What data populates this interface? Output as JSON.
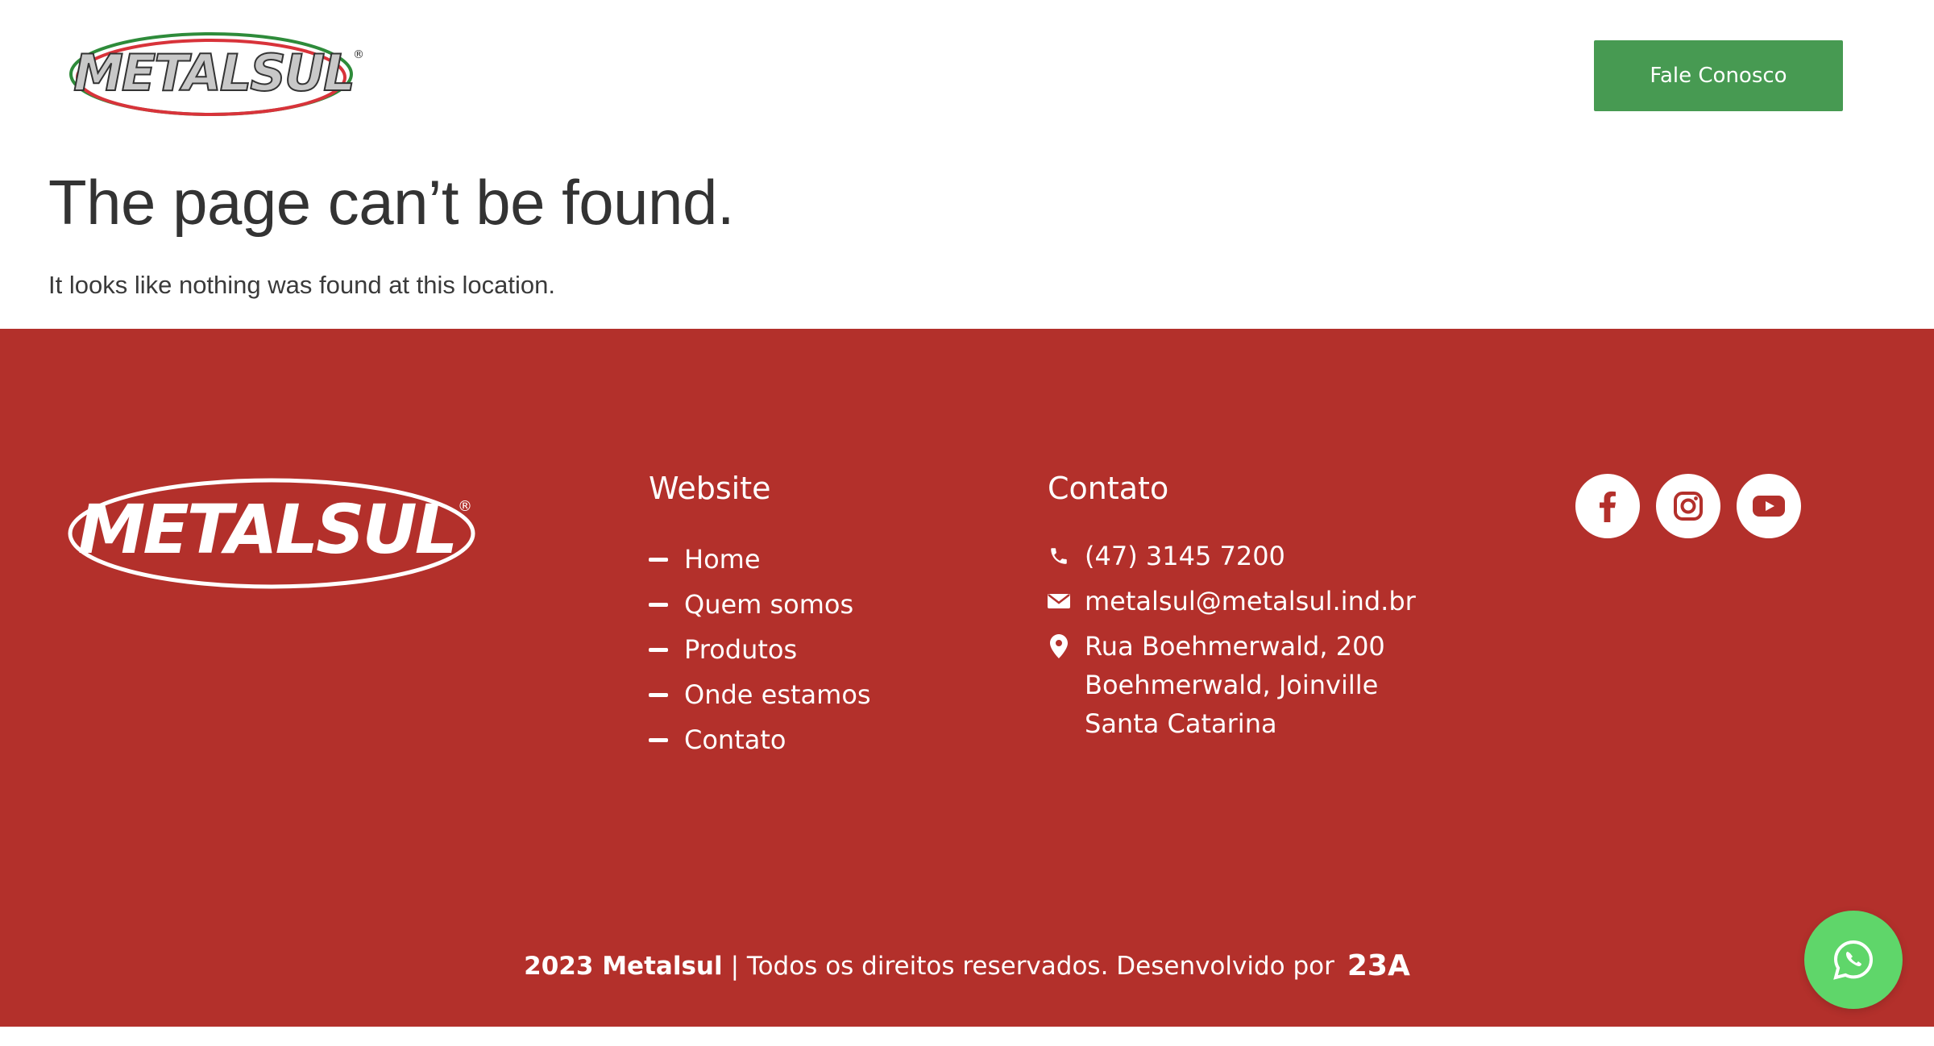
{
  "header": {
    "logo_text": "METALSUL",
    "cta_label": "Fale Conosco"
  },
  "error": {
    "title": "The page can’t be found.",
    "message": "It looks like nothing was found at this location."
  },
  "footer": {
    "logo_text": "METALSUL",
    "website": {
      "title": "Website",
      "links": [
        "Home",
        "Quem somos",
        "Produtos",
        "Onde estamos",
        "Contato"
      ]
    },
    "contact": {
      "title": "Contato",
      "phone": "(47) 3145 7200",
      "email": "metalsul@metalsul.ind.br",
      "address": [
        "Rua Boehmerwald, 200",
        "Boehmerwald, Joinville",
        "Santa Catarina"
      ]
    },
    "social": [
      "facebook-icon",
      "instagram-icon",
      "youtube-icon"
    ],
    "copyright": {
      "bold": "2023 Metalsul",
      "rest": "| Todos os direitos reservados. Desenvolvido por",
      "developer_mark": "23A"
    }
  },
  "colors": {
    "primary_green": "#479a52",
    "footer_red": "#b3302b",
    "whatsapp_green": "#5fd66a"
  }
}
